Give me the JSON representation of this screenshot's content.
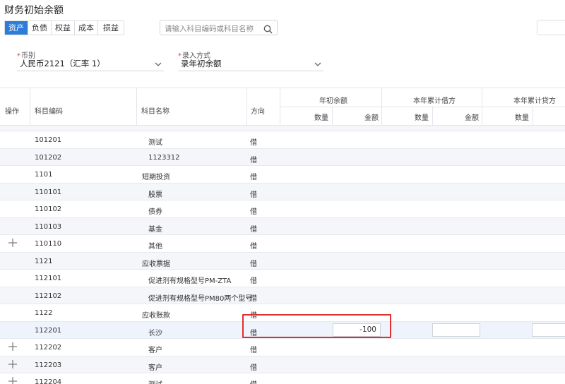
{
  "page": {
    "title": "财务初始余额"
  },
  "tabs": [
    {
      "label": "资产",
      "active": true
    },
    {
      "label": "负债",
      "active": false
    },
    {
      "label": "权益",
      "active": false
    },
    {
      "label": "成本",
      "active": false
    },
    {
      "label": "损益",
      "active": false
    }
  ],
  "search": {
    "placeholder": "请输入科目编码或科目名称"
  },
  "filters": {
    "currency": {
      "label": "币别",
      "value": "人民币2121（汇率 1）"
    },
    "entry_mode": {
      "label": "录入方式",
      "value": "录年初余额"
    }
  },
  "table": {
    "headers": {
      "op": "操作",
      "code": "科目编码",
      "name": "科目名称",
      "dir": "方向",
      "opening": "年初余额",
      "ytd_debit": "本年累计借方",
      "ytd_credit": "本年累计贷方",
      "qty": "数量",
      "amount": "金额"
    },
    "rows": [
      {
        "code": "101201",
        "name": "测试",
        "dir": "借",
        "indent": 2,
        "plus": false
      },
      {
        "code": "101202",
        "name": "1123312",
        "dir": "借",
        "indent": 2,
        "plus": false
      },
      {
        "code": "1101",
        "name": "短期投资",
        "dir": "借",
        "indent": 0,
        "plus": false
      },
      {
        "code": "110101",
        "name": "股票",
        "dir": "借",
        "indent": 2,
        "plus": false
      },
      {
        "code": "110102",
        "name": "债券",
        "dir": "借",
        "indent": 2,
        "plus": false
      },
      {
        "code": "110103",
        "name": "基金",
        "dir": "借",
        "indent": 2,
        "plus": false
      },
      {
        "code": "110110",
        "name": "其他",
        "dir": "借",
        "indent": 2,
        "plus": true
      },
      {
        "code": "1121",
        "name": "应收票据",
        "dir": "借",
        "indent": 0,
        "plus": false
      },
      {
        "code": "112101",
        "name": "促进剂有规格型号PM-ZTA",
        "dir": "借",
        "indent": 2,
        "plus": false
      },
      {
        "code": "112102",
        "name": "促进剂有规格型号PM80两个型号",
        "dir": "借",
        "indent": 2,
        "plus": false
      },
      {
        "code": "1122",
        "name": "应收账款",
        "dir": "借",
        "indent": 0,
        "plus": false
      },
      {
        "code": "112201",
        "name": "长沙",
        "dir": "借",
        "indent": 2,
        "plus": false,
        "editing": true,
        "opening_amount": "-100"
      },
      {
        "code": "112202",
        "name": "客户",
        "dir": "借",
        "indent": 2,
        "plus": true
      },
      {
        "code": "112203",
        "name": "客户",
        "dir": "借",
        "indent": 2,
        "plus": true
      },
      {
        "code": "112204",
        "name": "测试",
        "dir": "借",
        "indent": 2,
        "plus": true
      }
    ]
  },
  "colors": {
    "accent": "#2f7bd8",
    "highlight": "#e03131"
  }
}
